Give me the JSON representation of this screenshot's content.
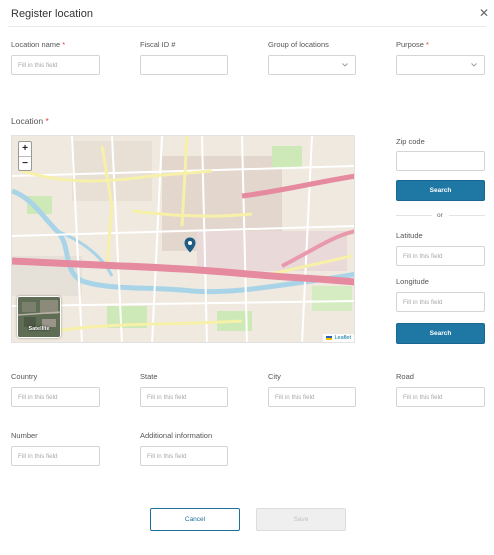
{
  "dialog": {
    "title": "Register location",
    "close_icon": "close-icon"
  },
  "fields": {
    "location_name": {
      "label": "Location name",
      "required": "*",
      "placeholder": "Fill in this field"
    },
    "fiscal_id": {
      "label": "Fiscal ID #"
    },
    "group": {
      "label": "Group of locations",
      "value": ""
    },
    "purpose": {
      "label": "Purpose",
      "required": "*",
      "value": ""
    }
  },
  "location_section": {
    "label": "Location",
    "required": "*"
  },
  "map": {
    "zoom_in": "+",
    "zoom_out": "−",
    "satellite_label": "Satellite",
    "attribution": "Leaflet",
    "marker_icon": "map-marker-icon"
  },
  "side": {
    "zip_label": "Zip code",
    "search_label": "Search",
    "or_label": "or",
    "latitude_label": "Latitude",
    "latitude_placeholder": "Fill in this field",
    "longitude_label": "Longitude",
    "longitude_placeholder": "Fill in this field",
    "search2_label": "Search"
  },
  "address": {
    "country": {
      "label": "Country",
      "placeholder": "Fill in this field"
    },
    "state": {
      "label": "State",
      "placeholder": "Fill in this field"
    },
    "city": {
      "label": "City",
      "placeholder": "Fill in this field"
    },
    "road": {
      "label": "Road",
      "placeholder": "Fill in this field"
    },
    "number": {
      "label": "Number",
      "placeholder": "Fill in this field"
    },
    "additional": {
      "label": "Additional information",
      "placeholder": "Fill in this field"
    }
  },
  "actions": {
    "cancel": "Cancel",
    "save": "Save"
  },
  "colors": {
    "primary": "#1f78a3",
    "required": "#e0413a",
    "map_highway": "#e68a9f",
    "map_water": "#a9d4e8",
    "map_park": "#cde9b7"
  }
}
